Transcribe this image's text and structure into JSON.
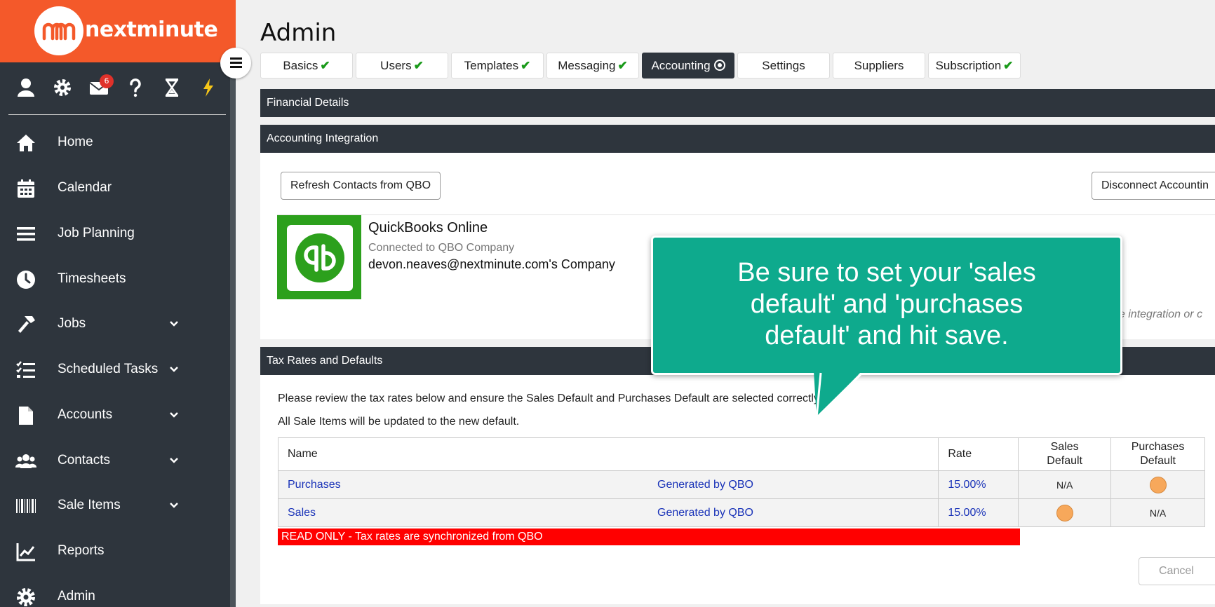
{
  "brand": {
    "logo_mark": "m",
    "name": "nextminute",
    "color": "#f4592a"
  },
  "toolbar": {
    "icons": [
      "user-icon",
      "gear-icon",
      "mail-icon",
      "help-icon",
      "hourglass-icon",
      "lightning-icon"
    ],
    "mail_badge": "6"
  },
  "sidebar": {
    "items": [
      {
        "label": "Home",
        "icon": "home-icon"
      },
      {
        "label": "Calendar",
        "icon": "calendar-icon"
      },
      {
        "label": "Job Planning",
        "icon": "list-icon"
      },
      {
        "label": "Timesheets",
        "icon": "clock-icon"
      },
      {
        "label": "Jobs",
        "icon": "hammer-icon",
        "has_submenu": true
      },
      {
        "label": "Scheduled Tasks",
        "icon": "checklist-icon",
        "has_submenu": true
      },
      {
        "label": "Accounts",
        "icon": "document-icon",
        "has_submenu": true
      },
      {
        "label": "Contacts",
        "icon": "users-icon",
        "has_submenu": true
      },
      {
        "label": "Sale Items",
        "icon": "barcode-icon",
        "has_submenu": true
      },
      {
        "label": "Reports",
        "icon": "chart-icon"
      },
      {
        "label": "Admin",
        "icon": "gear-icon"
      }
    ]
  },
  "page": {
    "title": "Admin"
  },
  "tabs": [
    {
      "label": "Basics",
      "status": "complete"
    },
    {
      "label": "Users",
      "status": "complete"
    },
    {
      "label": "Templates",
      "status": "complete"
    },
    {
      "label": "Messaging",
      "status": "complete"
    },
    {
      "label": "Accounting",
      "status": "active"
    },
    {
      "label": "Settings",
      "status": ""
    },
    {
      "label": "Suppliers",
      "status": ""
    },
    {
      "label": "Subscription",
      "status": "complete"
    }
  ],
  "sections": {
    "financial": "Financial Details",
    "integration": "Accounting Integration",
    "tax": "Tax Rates and Defaults"
  },
  "integration": {
    "refresh_button": "Refresh Contacts from QBO",
    "disconnect_button": "Disconnect Accountin",
    "provider": "QuickBooks Online",
    "connected_label": "Connected to QBO Company",
    "company": "devon.neaves@nextminute.com's Company",
    "note_fragment": "he integration or c"
  },
  "tax": {
    "instruction_1": "Please review the tax rates below and ensure the Sales Default and Purchases Default are selected correctly.",
    "instruction_2": "All Sale Items will be updated to the new default.",
    "columns": {
      "name": "Name",
      "rate": "Rate",
      "sales_default_1": "Sales",
      "sales_default_2": "Default",
      "purchases_default_1": "Purchases",
      "purchases_default_2": "Default"
    },
    "rows": [
      {
        "name": "Purchases",
        "source": "Generated by QBO",
        "rate": "15.00%",
        "sales_default": "N/A",
        "purchases_default": "selected"
      },
      {
        "name": "Sales",
        "source": "Generated by QBO",
        "rate": "15.00%",
        "sales_default": "selected",
        "purchases_default": "N/A"
      }
    ],
    "readonly_notice": "READ ONLY - Tax rates are synchronized from QBO",
    "cancel_button": "Cancel"
  },
  "callout": {
    "text": "Be sure to set your 'sales default' and 'purchases default' and hit save.",
    "color": "#0eaa8d"
  }
}
